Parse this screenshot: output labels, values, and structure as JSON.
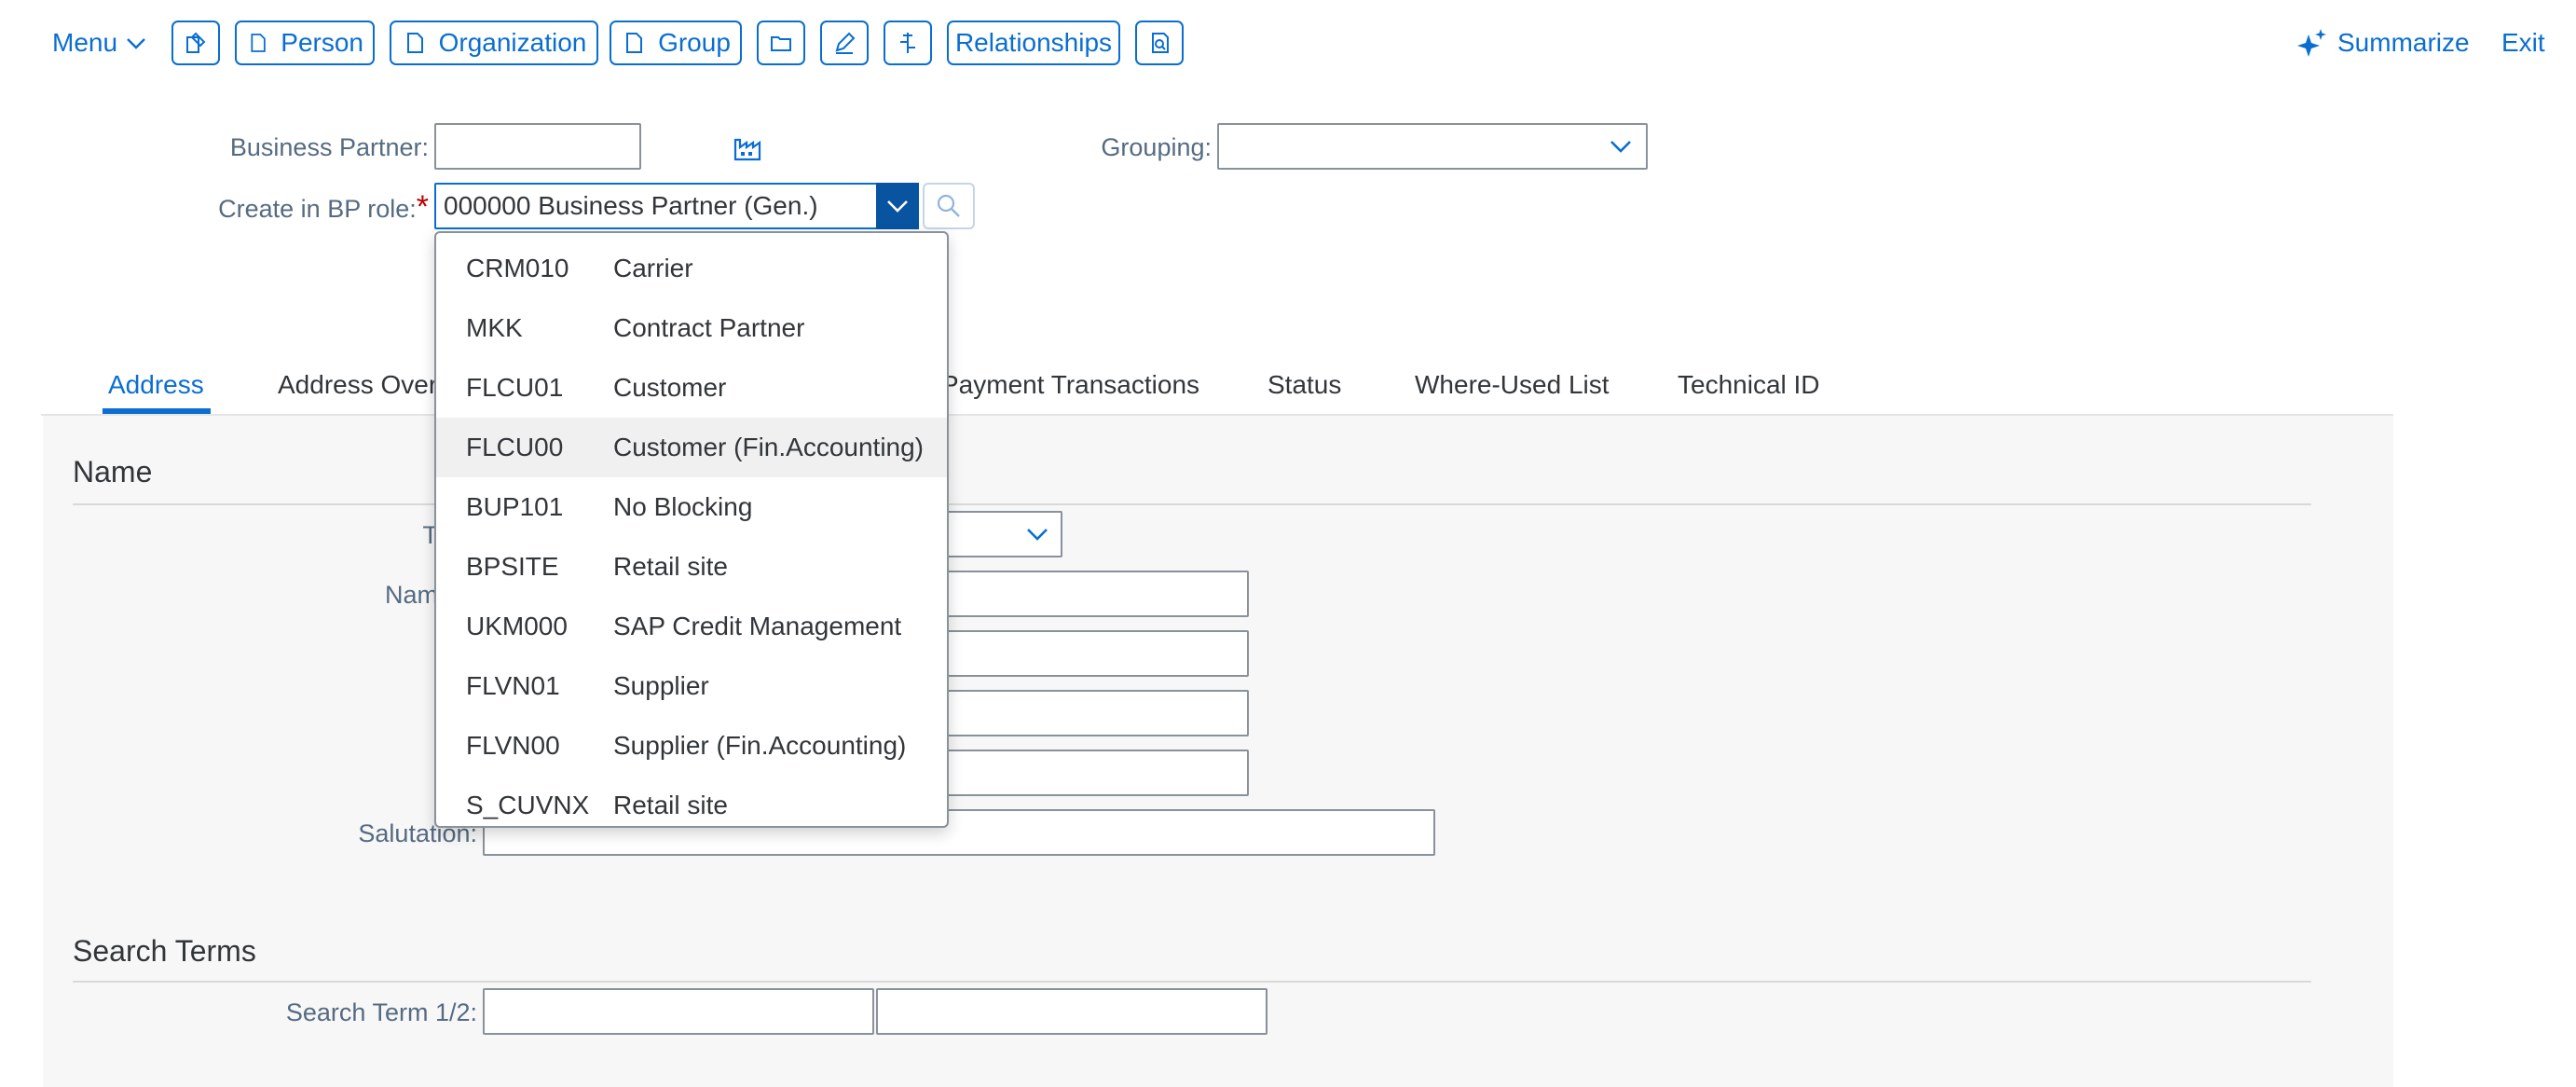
{
  "toolbar": {
    "menu_label": "Menu",
    "person_label": "Person",
    "organization_label": "Organization",
    "group_label": "Group",
    "relationships_label": "Relationships",
    "summarize_label": "Summarize",
    "exit_label": "Exit"
  },
  "form": {
    "business_partner_label": "Business Partner:",
    "business_partner_value": "",
    "grouping_label": "Grouping:",
    "grouping_value": "",
    "bp_role_label": "Create in BP role:",
    "bp_role_required_mark": "*",
    "bp_role_value": "000000 Business Partner (Gen.)"
  },
  "tabs": [
    {
      "label": "Address",
      "active": true
    },
    {
      "label": "Address Over"
    },
    {
      "label": "Payment Transactions"
    },
    {
      "label": "Status"
    },
    {
      "label": "Where-Used List"
    },
    {
      "label": "Technical ID"
    }
  ],
  "name_section": {
    "title": "Name",
    "title_label_partial": "T",
    "name_label_partial": "Nam",
    "salutation_label": "Salutation:"
  },
  "search_section": {
    "title": "Search Terms",
    "search_term_label": "Search Term 1/2:"
  },
  "dropdown": {
    "items": [
      {
        "code": "CRM010",
        "text": "Carrier"
      },
      {
        "code": "MKK",
        "text": "Contract Partner"
      },
      {
        "code": "FLCU01",
        "text": "Customer"
      },
      {
        "code": "FLCU00",
        "text": "Customer (Fin.Accounting)",
        "highlighted": true
      },
      {
        "code": "BUP101",
        "text": "No Blocking"
      },
      {
        "code": "BPSITE",
        "text": "Retail site"
      },
      {
        "code": "UKM000",
        "text": "SAP Credit Management"
      },
      {
        "code": "FLVN01",
        "text": "Supplier"
      },
      {
        "code": "FLVN00",
        "text": "Supplier (Fin.Accounting)"
      },
      {
        "code": "S_CUVNX",
        "text": "Retail site"
      }
    ]
  },
  "colors": {
    "accent": "#0a6ed1",
    "required": "#bb0000",
    "selected_dropdown_bg": "#0854a0"
  }
}
